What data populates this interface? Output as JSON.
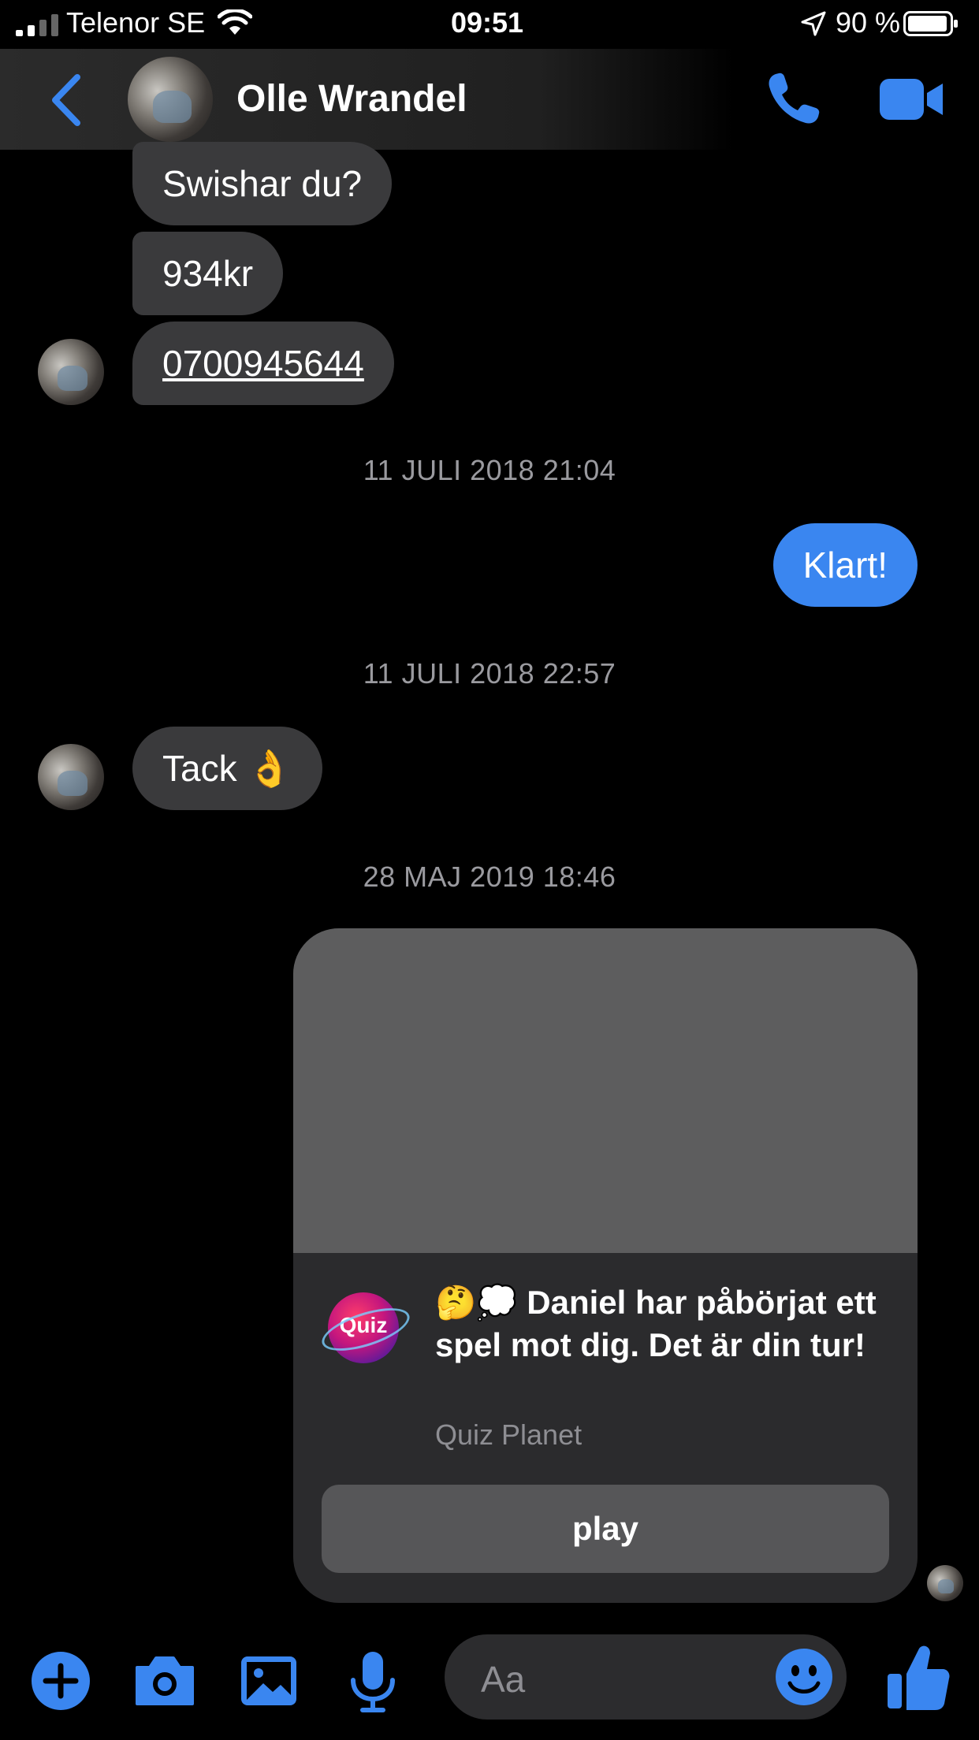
{
  "status_bar": {
    "carrier": "Telenor SE",
    "time": "09:51",
    "battery": "90 %"
  },
  "header": {
    "contact_name": "Olle Wrandel"
  },
  "messages": {
    "m1": "Swishar du?",
    "m2": "934kr",
    "m3": "0700945644",
    "stamp1": "11 JULI 2018 21:04",
    "m4": "Klart!",
    "stamp2": "11 JULI 2018 22:57",
    "m5": "Tack 👌",
    "stamp3": "28 MAJ 2019 18:46"
  },
  "quiz_card": {
    "logo_text": "Quiz",
    "text": "🤔💭 Daniel har påbörjat ett spel mot dig. Det är din tur!",
    "source": "Quiz Planet",
    "button": "play"
  },
  "composer": {
    "placeholder": "Aa"
  },
  "colors": {
    "accent": "#3a86f0",
    "incoming_bubble": "#3a3a3c",
    "background": "#000000"
  },
  "icons": [
    "signal-icon",
    "wifi-icon",
    "location-icon",
    "battery-icon",
    "back-chevron-icon",
    "phone-icon",
    "video-camera-icon",
    "plus-icon",
    "camera-icon",
    "image-icon",
    "microphone-icon",
    "emoji-icon",
    "thumbs-up-icon"
  ]
}
